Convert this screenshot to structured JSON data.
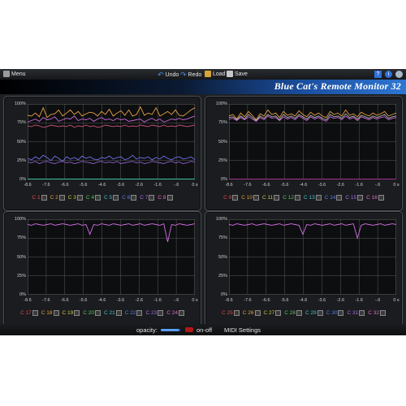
{
  "toolbar": {
    "menu_label": "Menu",
    "undo_label": "Undo",
    "redo_label": "Redo",
    "load_label": "Load",
    "save_label": "Save",
    "right_icons": [
      "help-icon",
      "info-icon",
      "settings-icon"
    ]
  },
  "app_title": "Blue Cat's Remote Monitor 32",
  "y_ticks": [
    "100%",
    "75%",
    "50%",
    "25%",
    "0%"
  ],
  "x_ticks": [
    "-8.6",
    "-7.6",
    "-6.6",
    "-5.6",
    "-4.6",
    "-3.6",
    "-2.6",
    "-1.6",
    "-.6",
    "0 s"
  ],
  "panels": [
    {
      "channels": [
        {
          "label": "C 1",
          "color": "#e34b4b"
        },
        {
          "label": "C 2",
          "color": "#e0a040"
        },
        {
          "label": "C 3",
          "color": "#c8c84a"
        },
        {
          "label": "C 4",
          "color": "#5ec45e"
        },
        {
          "label": "C 5",
          "color": "#4ac0c8"
        },
        {
          "label": "C 6",
          "color": "#5c7cf0"
        },
        {
          "label": "C 7",
          "color": "#a470e8"
        },
        {
          "label": "C 8",
          "color": "#e46cc8"
        }
      ],
      "series": [
        {
          "color": "#e6a040",
          "values": [
            85,
            84,
            88,
            83,
            95,
            82,
            86,
            87,
            92,
            84,
            88,
            92,
            86,
            90,
            84,
            87,
            89,
            88,
            84,
            90,
            86,
            93,
            84,
            88,
            91,
            85,
            92,
            84,
            86,
            96,
            85,
            88,
            86,
            95,
            84,
            87,
            90,
            86,
            92,
            85,
            84,
            88,
            92,
            95
          ]
        },
        {
          "color": "#c86bd8",
          "values": [
            76,
            78,
            80,
            77,
            82,
            79,
            80,
            83,
            77,
            79,
            81,
            80,
            84,
            78,
            80,
            79,
            81,
            77,
            80,
            82,
            79,
            80,
            78,
            81,
            79,
            80,
            77,
            78,
            79,
            80,
            76,
            79,
            81,
            78,
            80,
            76,
            78,
            80,
            79,
            81,
            79,
            80,
            82,
            84
          ]
        },
        {
          "color": "#c85078",
          "values": [
            71,
            70,
            72,
            71,
            69,
            70,
            72,
            71,
            70,
            71,
            70,
            72,
            69,
            71,
            70,
            72,
            70,
            71,
            69,
            70,
            72,
            71,
            70,
            71,
            70,
            72,
            70,
            71,
            70,
            72,
            71,
            70,
            72,
            71,
            70,
            72,
            70,
            71,
            70,
            72,
            71,
            70,
            71,
            72
          ]
        },
        {
          "color": "#7070e8",
          "values": [
            28,
            26,
            30,
            27,
            32,
            29,
            25,
            31,
            28,
            24,
            30,
            27,
            29,
            26,
            31,
            28,
            30,
            27,
            26,
            29,
            28,
            31,
            27,
            29,
            30,
            26,
            28,
            32,
            27,
            29,
            28,
            30,
            26,
            29,
            27,
            31,
            28,
            26,
            29,
            30,
            27,
            28,
            30,
            26
          ]
        },
        {
          "color": "#8a5ec8",
          "values": [
            23,
            22,
            24,
            21,
            23,
            24,
            22,
            21,
            23,
            24,
            22,
            23,
            21,
            22,
            24,
            23,
            22,
            21,
            23,
            24,
            22,
            23,
            22,
            24,
            21,
            22,
            23,
            24,
            22,
            23,
            21,
            22,
            24,
            23,
            22,
            21,
            23,
            24,
            22,
            23,
            21,
            22,
            24,
            23
          ]
        },
        {
          "color": "#3cc0a0",
          "values": [
            0.5,
            0.5,
            0.5,
            0.5,
            0.5,
            0.5,
            0.5,
            0.5,
            0.5,
            0.5,
            0.5,
            0.5,
            0.5,
            0.5,
            0.5,
            0.5,
            0.5,
            0.5,
            0.5,
            0.5,
            0.5,
            0.5,
            0.5,
            0.5,
            0.5,
            0.5,
            0.5,
            0.5,
            0.5,
            0.5,
            0.5,
            0.5,
            0.5,
            0.5,
            0.5,
            0.5,
            0.5,
            0.5,
            0.5,
            0.5,
            0.5,
            0.5,
            0.5,
            0.5
          ]
        }
      ]
    },
    {
      "channels": [
        {
          "label": "C 9",
          "color": "#e34b4b"
        },
        {
          "label": "C 10",
          "color": "#e0a040"
        },
        {
          "label": "C 11",
          "color": "#c8c84a"
        },
        {
          "label": "C 12",
          "color": "#5ec45e"
        },
        {
          "label": "C 13",
          "color": "#4ac0c8"
        },
        {
          "label": "C 14",
          "color": "#5c7cf0"
        },
        {
          "label": "C 15",
          "color": "#a470e8"
        },
        {
          "label": "C 16",
          "color": "#e46cc8"
        }
      ],
      "series": [
        {
          "color": "#e6a040",
          "values": [
            84,
            86,
            80,
            88,
            83,
            90,
            85,
            79,
            87,
            84,
            92,
            86,
            88,
            82,
            90,
            85,
            87,
            84,
            91,
            86,
            83,
            89,
            85,
            88,
            84,
            82,
            90,
            86,
            88,
            84,
            92,
            85,
            87,
            83,
            89,
            86,
            84,
            88,
            85,
            87,
            90,
            84,
            86,
            88
          ]
        },
        {
          "color": "#b0b0b0",
          "values": [
            82,
            83,
            79,
            84,
            80,
            86,
            82,
            78,
            84,
            81,
            86,
            83,
            84,
            79,
            86,
            82,
            84,
            81,
            86,
            83,
            80,
            85,
            82,
            84,
            81,
            79,
            86,
            83,
            84,
            81,
            87,
            82,
            84,
            80,
            85,
            83,
            81,
            84,
            82,
            84,
            86,
            81,
            83,
            84
          ]
        },
        {
          "color": "#c86bd8",
          "values": [
            80,
            81,
            78,
            82,
            79,
            83,
            80,
            77,
            82,
            79,
            84,
            81,
            82,
            78,
            83,
            80,
            82,
            79,
            84,
            81,
            78,
            83,
            80,
            82,
            79,
            77,
            83,
            81,
            82,
            79,
            84,
            80,
            82,
            78,
            83,
            81,
            79,
            82,
            80,
            82,
            83,
            79,
            81,
            82
          ]
        },
        {
          "color": "#a03090",
          "values": [
            0.5,
            0.5,
            0.5,
            0.5,
            0.5,
            0.5,
            0.5,
            0.5,
            0.5,
            0.5,
            0.5,
            0.5,
            0.5,
            0.5,
            0.5,
            0.5,
            0.5,
            0.5,
            0.5,
            0.5,
            0.5,
            0.5,
            0.5,
            0.5,
            0.5,
            0.5,
            0.5,
            0.5,
            0.5,
            0.5,
            0.5,
            0.5,
            0.5,
            0.5,
            0.5,
            0.5,
            0.5,
            0.5,
            0.5,
            0.5,
            0.5,
            0.5,
            0.5,
            0.5
          ]
        }
      ]
    },
    {
      "channels": [
        {
          "label": "C 17",
          "color": "#e34b4b"
        },
        {
          "label": "C 18",
          "color": "#e0a040"
        },
        {
          "label": "C 19",
          "color": "#c8c84a"
        },
        {
          "label": "C 20",
          "color": "#5ec45e"
        },
        {
          "label": "C 21",
          "color": "#4ac0c8"
        },
        {
          "label": "C 22",
          "color": "#5c7cf0"
        },
        {
          "label": "C 23",
          "color": "#a470e8"
        },
        {
          "label": "C 24",
          "color": "#e46cc8"
        }
      ],
      "series": [
        {
          "color": "#d070e0",
          "values": [
            93,
            92,
            94,
            93,
            92,
            93,
            94,
            92,
            93,
            94,
            93,
            92,
            93,
            94,
            92,
            93,
            80,
            93,
            92,
            94,
            93,
            92,
            94,
            93,
            92,
            93,
            94,
            92,
            93,
            94,
            92,
            93,
            94,
            93,
            92,
            94,
            70,
            93,
            92,
            94,
            93,
            92,
            93,
            94
          ]
        }
      ]
    },
    {
      "channels": [
        {
          "label": "C 25",
          "color": "#e34b4b"
        },
        {
          "label": "C 26",
          "color": "#e0a040"
        },
        {
          "label": "C 27",
          "color": "#c8c84a"
        },
        {
          "label": "C 28",
          "color": "#5ec45e"
        },
        {
          "label": "C 29",
          "color": "#4ac0c8"
        },
        {
          "label": "C 30",
          "color": "#5c7cf0"
        },
        {
          "label": "C 31",
          "color": "#a470e8"
        },
        {
          "label": "C 32",
          "color": "#e46cc8"
        }
      ],
      "series": [
        {
          "color": "#d070e0",
          "values": [
            93,
            92,
            94,
            93,
            92,
            93,
            94,
            92,
            93,
            94,
            93,
            92,
            93,
            94,
            92,
            93,
            94,
            93,
            92,
            80,
            93,
            92,
            94,
            93,
            92,
            93,
            94,
            92,
            93,
            94,
            92,
            93,
            94,
            75,
            92,
            94,
            93,
            92,
            93,
            94,
            92,
            93,
            94,
            93
          ]
        }
      ]
    }
  ],
  "bottom": {
    "opacity_label": "opacity:",
    "opacity_value": 0.9,
    "onoff_label": "on-off",
    "midi_label": "MIDI Settings"
  }
}
